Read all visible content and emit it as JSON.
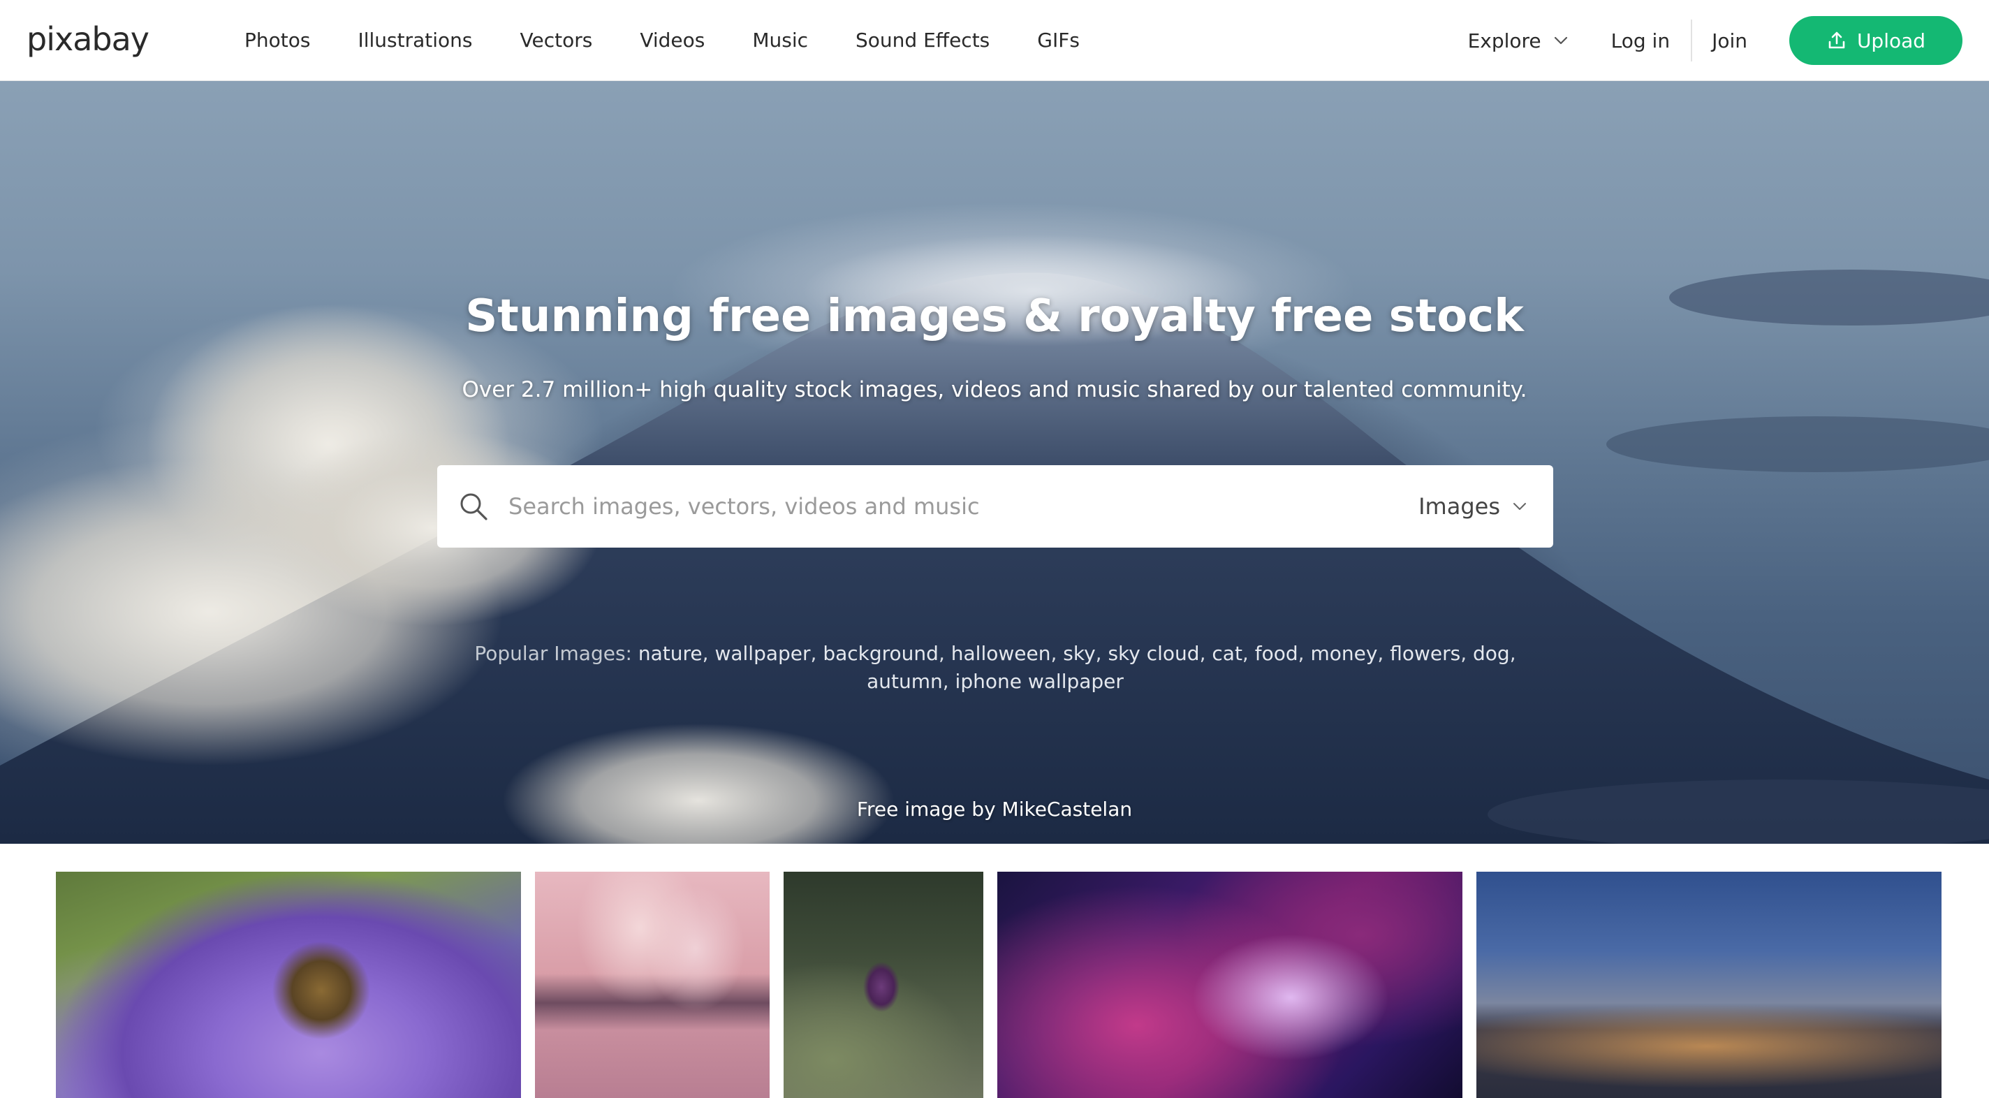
{
  "header": {
    "logo": "pixabay",
    "nav": [
      "Photos",
      "Illustrations",
      "Vectors",
      "Videos",
      "Music",
      "Sound Effects",
      "GIFs"
    ],
    "explore_label": "Explore",
    "login_label": "Log in",
    "join_label": "Join",
    "upload_label": "Upload",
    "upload_color": "#14b873"
  },
  "hero": {
    "title": "Stunning free images & royalty free stock",
    "subtitle": "Over 2.7 million+ high quality stock images, videos and music shared by our talented community.",
    "search": {
      "placeholder": "Search images, vectors, videos and music",
      "type_selected": "Images"
    },
    "popular_label": "Popular Images:",
    "popular_tags": [
      "nature",
      "wallpaper",
      "background",
      "halloween",
      "sky",
      "sky cloud",
      "cat",
      "food",
      "money",
      "flowers",
      "dog",
      "autumn",
      "iphone wallpaper"
    ],
    "credit": "Free image by MikeCastelan"
  },
  "gallery": {
    "items": [
      "bee-on-purple-flower",
      "power-plant-smoke-pink-sky",
      "purple-fritillary-flower",
      "abstract-purple-crystal",
      "harbor-city-dusk"
    ]
  }
}
